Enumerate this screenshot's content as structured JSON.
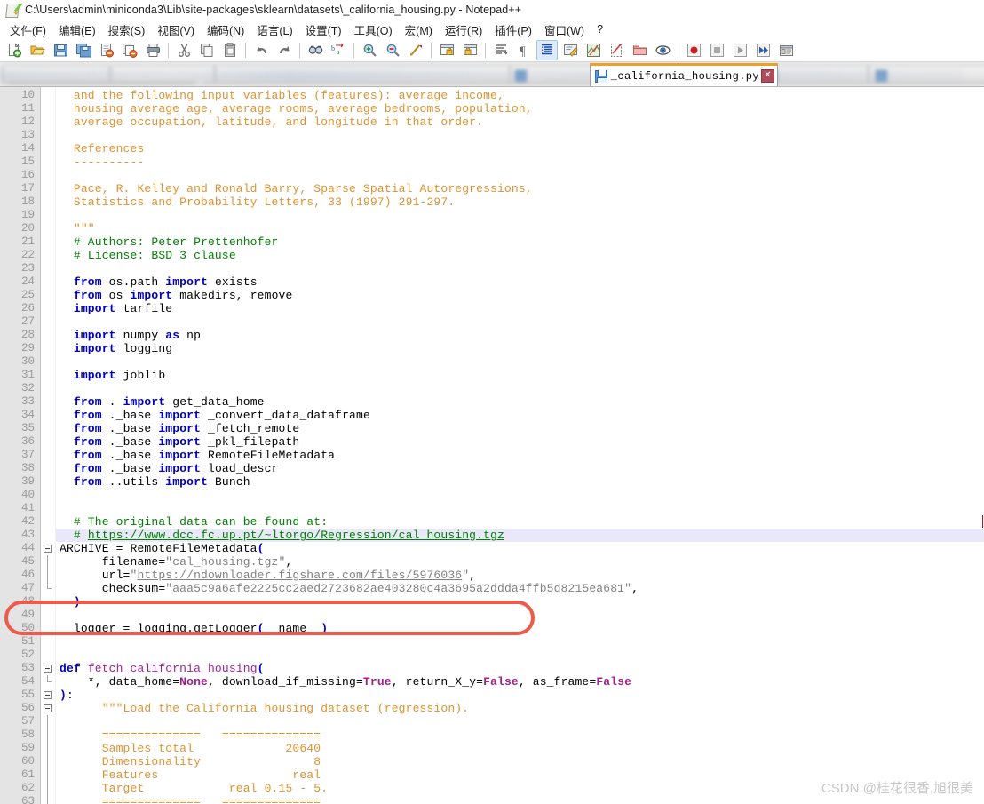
{
  "window": {
    "title": "C:\\Users\\admin\\miniconda3\\Lib\\site-packages\\sklearn\\datasets\\_california_housing.py - Notepad++",
    "app_icon": "notepad-plus-plus-icon"
  },
  "menubar": {
    "items": [
      {
        "label": "文件(F)",
        "name": "menu-file"
      },
      {
        "label": "编辑(E)",
        "name": "menu-edit"
      },
      {
        "label": "搜索(S)",
        "name": "menu-search"
      },
      {
        "label": "视图(V)",
        "name": "menu-view"
      },
      {
        "label": "编码(N)",
        "name": "menu-encoding"
      },
      {
        "label": "语言(L)",
        "name": "menu-language"
      },
      {
        "label": "设置(T)",
        "name": "menu-settings"
      },
      {
        "label": "工具(O)",
        "name": "menu-tools"
      },
      {
        "label": "宏(M)",
        "name": "menu-macro"
      },
      {
        "label": "运行(R)",
        "name": "menu-run"
      },
      {
        "label": "插件(P)",
        "name": "menu-plugins"
      },
      {
        "label": "窗口(W)",
        "name": "menu-window"
      },
      {
        "label": "?",
        "name": "menu-help"
      }
    ]
  },
  "toolbar": {
    "buttons": [
      "new-file-icon",
      "open-file-icon",
      "save-icon",
      "save-all-icon",
      "close-file-icon",
      "close-all-icon",
      "print-icon",
      "cut-icon",
      "copy-icon",
      "paste-icon",
      "undo-icon",
      "redo-icon",
      "find-icon",
      "replace-icon",
      "zoom-in-icon",
      "zoom-out-icon",
      "sync-scroll-icon",
      "word-wrap-icon",
      "all-chars-icon",
      "indent-guide-icon",
      "user-lang-icon",
      "doc-map-icon",
      "function-list-icon",
      "folder-as-workspace-icon",
      "monitoring-icon",
      "record-macro-icon",
      "stop-macro-icon",
      "play-macro-icon",
      "play-multiple-icon",
      "save-macro-icon"
    ]
  },
  "tabbar": {
    "active_tab": {
      "label": "_california_housing.py",
      "save_icon": "save-disk-icon",
      "close_icon": "close-x-icon"
    }
  },
  "editor": {
    "first_line_number": 10,
    "lines": [
      {
        "n": 10,
        "tokens": [
          {
            "c": "t-doc",
            "t": "  and the following input variables (features): average income,"
          }
        ]
      },
      {
        "n": 11,
        "tokens": [
          {
            "c": "t-doc",
            "t": "  housing average age, average rooms, average bedrooms, population,"
          }
        ]
      },
      {
        "n": 12,
        "tokens": [
          {
            "c": "t-doc",
            "t": "  average occupation, latitude, and longitude in that order."
          }
        ]
      },
      {
        "n": 13,
        "tokens": []
      },
      {
        "n": 14,
        "tokens": [
          {
            "c": "t-doc",
            "t": "  References"
          }
        ]
      },
      {
        "n": 15,
        "tokens": [
          {
            "c": "t-doc",
            "t": "  ----------"
          }
        ]
      },
      {
        "n": 16,
        "tokens": []
      },
      {
        "n": 17,
        "tokens": [
          {
            "c": "t-doc",
            "t": "  Pace, R. Kelley and Ronald Barry, Sparse Spatial Autoregressions,"
          }
        ]
      },
      {
        "n": 18,
        "tokens": [
          {
            "c": "t-doc",
            "t": "  Statistics and Probability Letters, 33 (1997) 291-297."
          }
        ]
      },
      {
        "n": 19,
        "tokens": []
      },
      {
        "n": 20,
        "tokens": [
          {
            "c": "t-doc",
            "t": "  \"\"\""
          }
        ]
      },
      {
        "n": 21,
        "tokens": [
          {
            "c": "t-com",
            "t": "  # Authors: Peter Prettenhofer"
          }
        ]
      },
      {
        "n": 22,
        "tokens": [
          {
            "c": "t-com",
            "t": "  # License: BSD 3 clause"
          }
        ]
      },
      {
        "n": 23,
        "tokens": []
      },
      {
        "n": 24,
        "tokens": [
          {
            "c": "t-kw",
            "t": "  from"
          },
          {
            "c": "t-plain",
            "t": " os.path "
          },
          {
            "c": "t-kw",
            "t": "import"
          },
          {
            "c": "t-plain",
            "t": " exists"
          }
        ]
      },
      {
        "n": 25,
        "tokens": [
          {
            "c": "t-kw",
            "t": "  from"
          },
          {
            "c": "t-plain",
            "t": " os "
          },
          {
            "c": "t-kw",
            "t": "import"
          },
          {
            "c": "t-plain",
            "t": " makedirs, remove"
          }
        ]
      },
      {
        "n": 26,
        "tokens": [
          {
            "c": "t-kw",
            "t": "  import"
          },
          {
            "c": "t-plain",
            "t": " tarfile"
          }
        ]
      },
      {
        "n": 27,
        "tokens": []
      },
      {
        "n": 28,
        "tokens": [
          {
            "c": "t-kw",
            "t": "  import"
          },
          {
            "c": "t-plain",
            "t": " numpy "
          },
          {
            "c": "t-kw",
            "t": "as"
          },
          {
            "c": "t-plain",
            "t": " np"
          }
        ]
      },
      {
        "n": 29,
        "tokens": [
          {
            "c": "t-kw",
            "t": "  import"
          },
          {
            "c": "t-plain",
            "t": " logging"
          }
        ]
      },
      {
        "n": 30,
        "tokens": []
      },
      {
        "n": 31,
        "tokens": [
          {
            "c": "t-kw",
            "t": "  import"
          },
          {
            "c": "t-plain",
            "t": " joblib"
          }
        ]
      },
      {
        "n": 32,
        "tokens": []
      },
      {
        "n": 33,
        "tokens": [
          {
            "c": "t-kw",
            "t": "  from"
          },
          {
            "c": "t-plain",
            "t": " . "
          },
          {
            "c": "t-kw",
            "t": "import"
          },
          {
            "c": "t-plain",
            "t": " get_data_home"
          }
        ]
      },
      {
        "n": 34,
        "tokens": [
          {
            "c": "t-kw",
            "t": "  from"
          },
          {
            "c": "t-plain",
            "t": " ._base "
          },
          {
            "c": "t-kw",
            "t": "import"
          },
          {
            "c": "t-plain",
            "t": " _convert_data_dataframe"
          }
        ]
      },
      {
        "n": 35,
        "tokens": [
          {
            "c": "t-kw",
            "t": "  from"
          },
          {
            "c": "t-plain",
            "t": " ._base "
          },
          {
            "c": "t-kw",
            "t": "import"
          },
          {
            "c": "t-plain",
            "t": " _fetch_remote"
          }
        ]
      },
      {
        "n": 36,
        "tokens": [
          {
            "c": "t-kw",
            "t": "  from"
          },
          {
            "c": "t-plain",
            "t": " ._base "
          },
          {
            "c": "t-kw",
            "t": "import"
          },
          {
            "c": "t-plain",
            "t": " _pkl_filepath"
          }
        ]
      },
      {
        "n": 37,
        "tokens": [
          {
            "c": "t-kw",
            "t": "  from"
          },
          {
            "c": "t-plain",
            "t": " ._base "
          },
          {
            "c": "t-kw",
            "t": "import"
          },
          {
            "c": "t-plain",
            "t": " RemoteFileMetadata"
          }
        ]
      },
      {
        "n": 38,
        "tokens": [
          {
            "c": "t-kw",
            "t": "  from"
          },
          {
            "c": "t-plain",
            "t": " ._base "
          },
          {
            "c": "t-kw",
            "t": "import"
          },
          {
            "c": "t-plain",
            "t": " load_descr"
          }
        ]
      },
      {
        "n": 39,
        "tokens": [
          {
            "c": "t-kw",
            "t": "  from"
          },
          {
            "c": "t-plain",
            "t": " ..utils "
          },
          {
            "c": "t-kw",
            "t": "import"
          },
          {
            "c": "t-plain",
            "t": " Bunch"
          }
        ]
      },
      {
        "n": 40,
        "tokens": []
      },
      {
        "n": 41,
        "tokens": []
      },
      {
        "n": 42,
        "tokens": [
          {
            "c": "t-com",
            "t": "  # The original data can be found at:"
          }
        ]
      },
      {
        "n": 43,
        "hl": true,
        "tokens": [
          {
            "c": "t-com",
            "t": "  # "
          },
          {
            "c": "t-url",
            "t": "https://www.dcc.fc.up.pt/~ltorgo/Regression/cal_housing.tgz"
          }
        ]
      },
      {
        "n": 44,
        "fold": "open",
        "tokens": [
          {
            "c": "t-plain",
            "t": "ARCHIVE = RemoteFileMetadata"
          },
          {
            "c": "t-paren",
            "t": "("
          }
        ]
      },
      {
        "n": 45,
        "foldline": true,
        "tokens": [
          {
            "c": "t-plain",
            "t": "      filename="
          },
          {
            "c": "t-q",
            "t": "\""
          },
          {
            "c": "t-str",
            "t": "cal_housing.tgz"
          },
          {
            "c": "t-q",
            "t": "\""
          },
          {
            "c": "t-plain",
            "t": ","
          }
        ]
      },
      {
        "n": 46,
        "foldline": true,
        "tokens": [
          {
            "c": "t-plain",
            "t": "      url="
          },
          {
            "c": "t-q",
            "t": "\""
          },
          {
            "c": "t-urlg",
            "t": "https://ndownloader.figshare.com/files/5976036"
          },
          {
            "c": "t-q",
            "t": "\""
          },
          {
            "c": "t-plain",
            "t": ","
          }
        ]
      },
      {
        "n": 47,
        "foldend": true,
        "tokens": [
          {
            "c": "t-plain",
            "t": "      checksum="
          },
          {
            "c": "t-q",
            "t": "\""
          },
          {
            "c": "t-str",
            "t": "aaa5c9a6afe2225cc2aed2723682ae403280c4a3695a2ddda4ffb5d8215ea681"
          },
          {
            "c": "t-q",
            "t": "\""
          },
          {
            "c": "t-plain",
            "t": ","
          }
        ]
      },
      {
        "n": 48,
        "tokens": [
          {
            "c": "t-paren",
            "t": "  )"
          }
        ]
      },
      {
        "n": 49,
        "tokens": []
      },
      {
        "n": 50,
        "tokens": [
          {
            "c": "t-plain",
            "t": "  logger = logging.getLogger"
          },
          {
            "c": "t-paren",
            "t": "("
          },
          {
            "c": "t-plain",
            "t": "__name__"
          },
          {
            "c": "t-paren",
            "t": ")"
          }
        ]
      },
      {
        "n": 51,
        "tokens": []
      },
      {
        "n": 52,
        "tokens": []
      },
      {
        "n": 53,
        "fold": "open",
        "tokens": [
          {
            "c": "t-def",
            "t": "def"
          },
          {
            "c": "t-plain",
            "t": " "
          },
          {
            "c": "t-fn",
            "t": "fetch_california_housing"
          },
          {
            "c": "t-paren",
            "t": "("
          }
        ]
      },
      {
        "n": 54,
        "foldend": true,
        "tokens": [
          {
            "c": "t-plain",
            "t": "    *, data_home="
          },
          {
            "c": "t-lit",
            "t": "None"
          },
          {
            "c": "t-plain",
            "t": ", download_if_missing="
          },
          {
            "c": "t-lit",
            "t": "True"
          },
          {
            "c": "t-plain",
            "t": ", return_X_y="
          },
          {
            "c": "t-lit",
            "t": "False"
          },
          {
            "c": "t-plain",
            "t": ", as_frame="
          },
          {
            "c": "t-lit",
            "t": "False"
          }
        ]
      },
      {
        "n": 55,
        "fold": "open",
        "tokens": [
          {
            "c": "t-paren",
            "t": ")"
          },
          {
            "c": "t-plain",
            "t": ":"
          }
        ]
      },
      {
        "n": 56,
        "fold": "open2",
        "tokens": [
          {
            "c": "t-doc",
            "t": "      \"\"\"Load the California housing dataset (regression)."
          }
        ]
      },
      {
        "n": 57,
        "foldline": true,
        "tokens": []
      },
      {
        "n": 58,
        "foldline": true,
        "tokens": [
          {
            "c": "t-doc",
            "t": "      ==============   =============="
          }
        ]
      },
      {
        "n": 59,
        "foldline": true,
        "tokens": [
          {
            "c": "t-doc",
            "t": "      Samples total             20640"
          }
        ]
      },
      {
        "n": 60,
        "foldline": true,
        "tokens": [
          {
            "c": "t-doc",
            "t": "      Dimensionality                8"
          }
        ]
      },
      {
        "n": 61,
        "foldline": true,
        "tokens": [
          {
            "c": "t-doc",
            "t": "      Features                   real"
          }
        ]
      },
      {
        "n": 62,
        "foldline": true,
        "tokens": [
          {
            "c": "t-doc",
            "t": "      Target            real 0.15 - 5."
          }
        ]
      },
      {
        "n": 63,
        "foldline": true,
        "tokens": [
          {
            "c": "t-doc",
            "t": "      ==============   =============="
          }
        ]
      }
    ]
  },
  "annotation": {
    "type": "red-rounded-rectangle-highlight",
    "color": "#f05a4a",
    "covers_lines": "42-44"
  },
  "watermark": {
    "text": "CSDN @桂花很香,旭很美"
  }
}
